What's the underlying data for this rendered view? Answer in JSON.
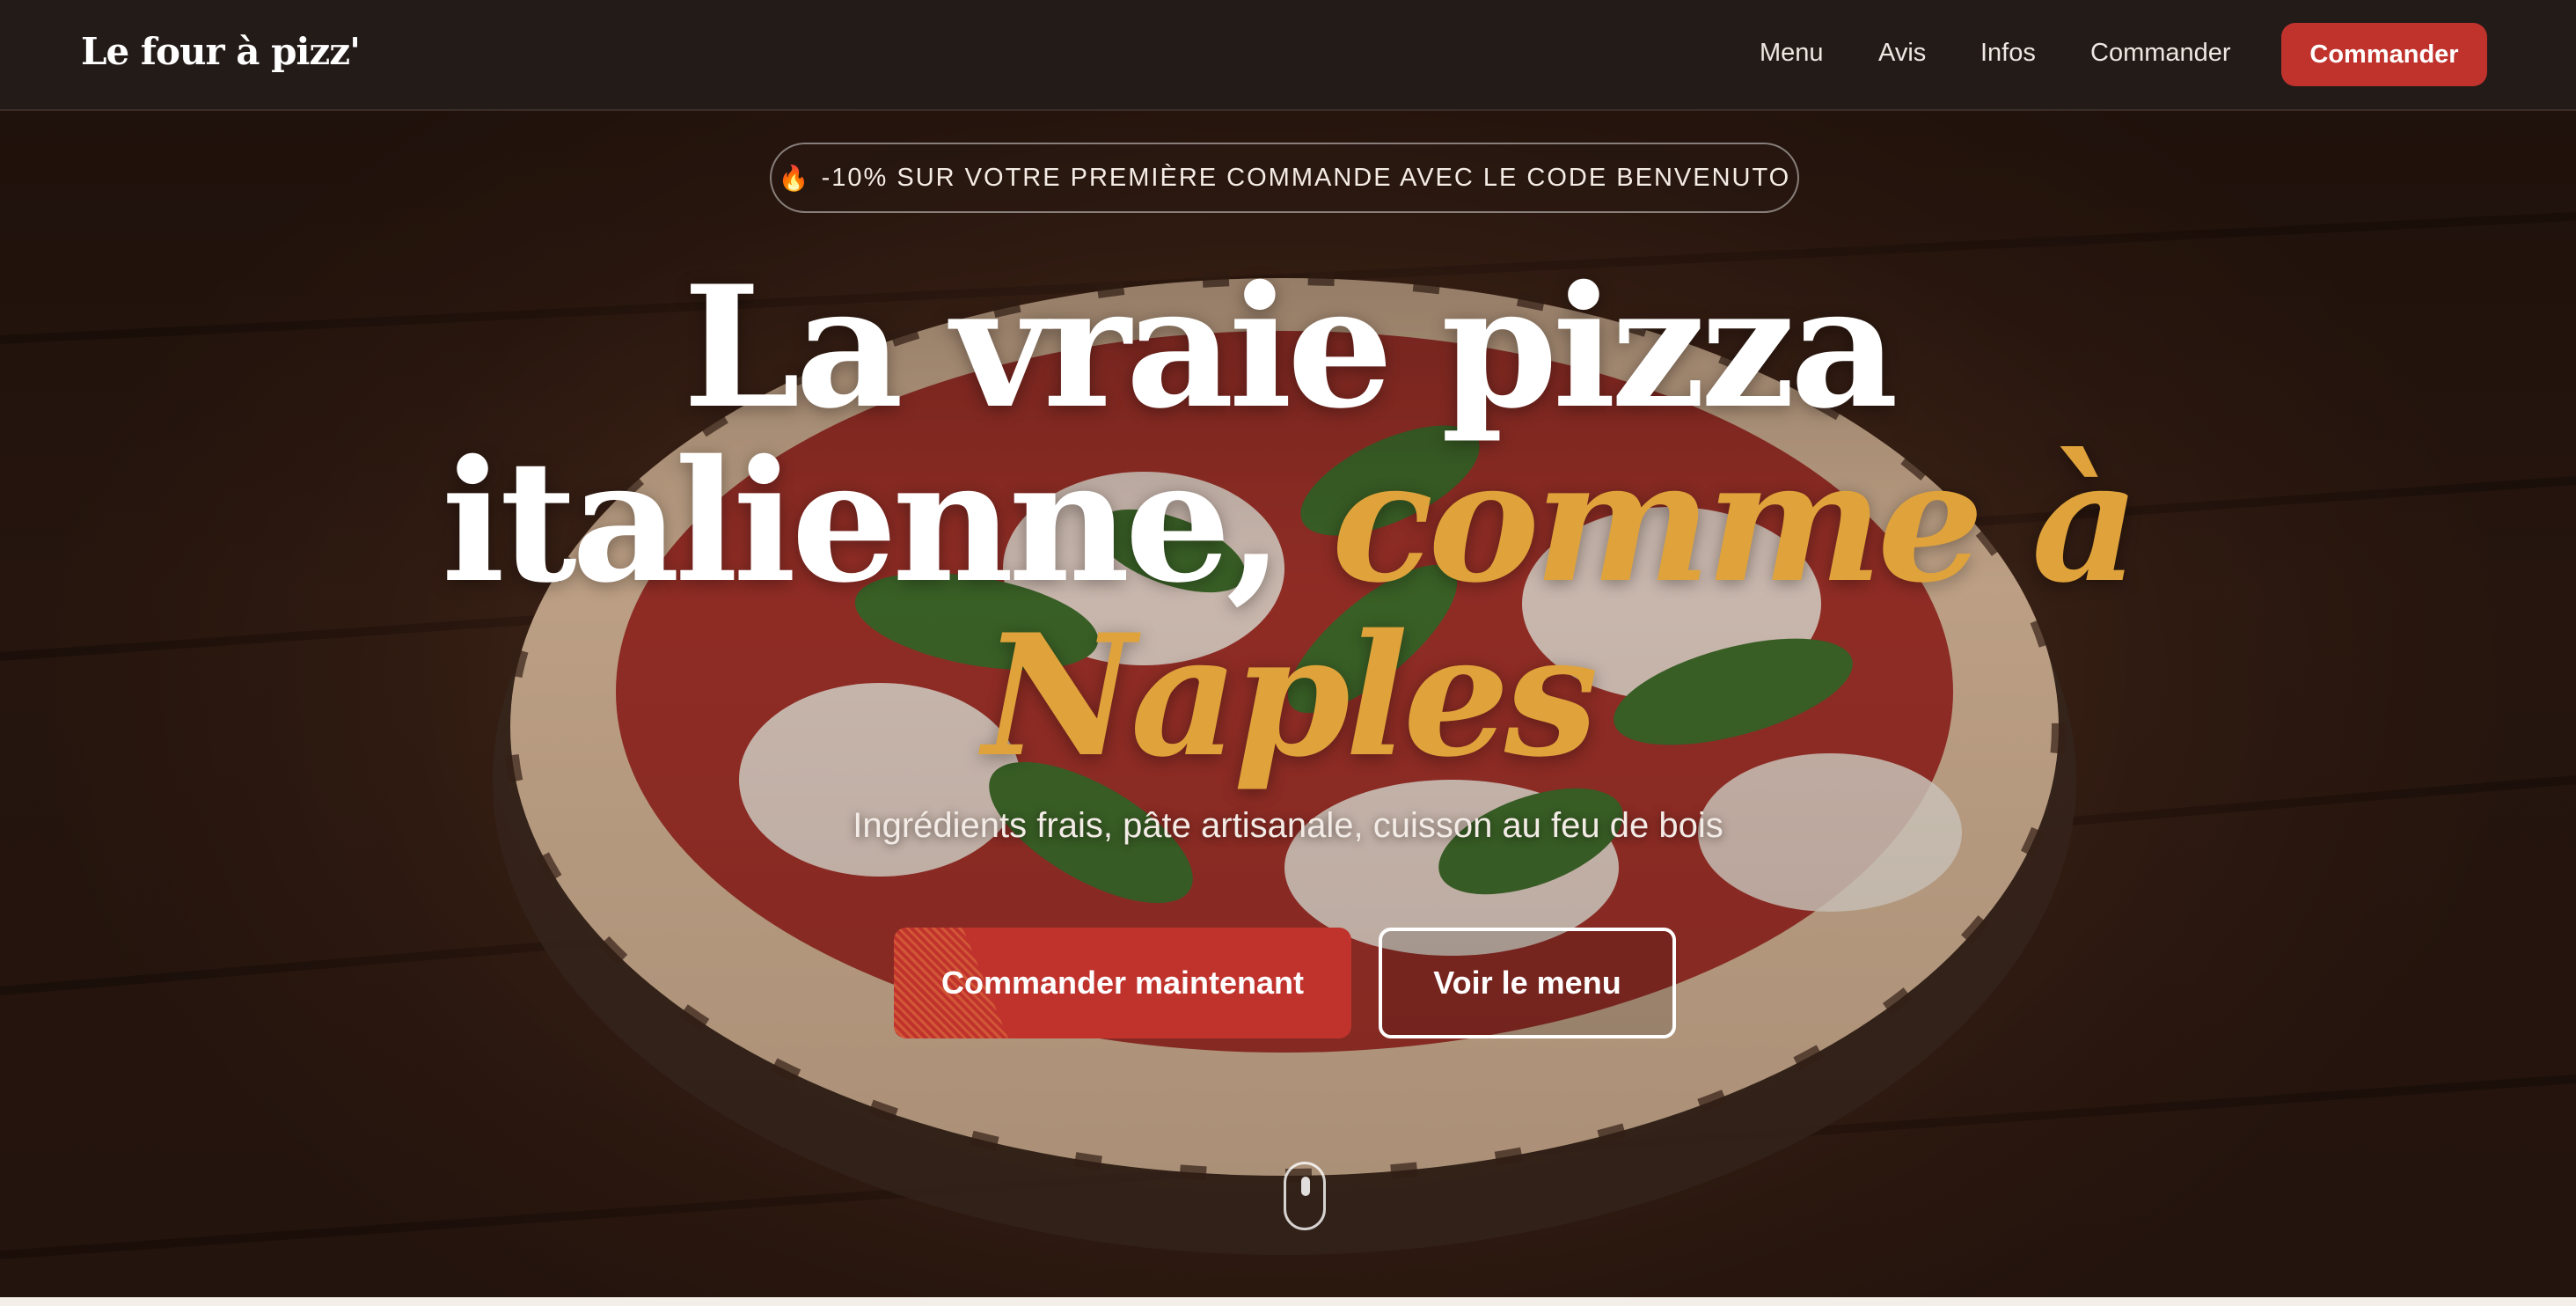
{
  "header": {
    "logo": "Le four à pizz'",
    "nav": {
      "menu": "Menu",
      "avis": "Avis",
      "infos": "Infos",
      "commander": "Commander"
    },
    "cta_label": "Commander"
  },
  "hero": {
    "promo_icon": "fire-icon",
    "promo_text": "-10% SUR VOTRE PREMIÈRE COMMANDE AVEC LE CODE BENVENUTO",
    "headline": {
      "line1": "La vraie pizza",
      "line2_plain": "italienne, ",
      "line2_accent": "comme à",
      "line3_accent": "Naples"
    },
    "subtitle": "Ingrédients frais, pâte artisanale, cuisson au feu de bois",
    "primary_button": "Commander maintenant",
    "secondary_button": "Voir le menu"
  },
  "colors": {
    "brand_red": "#c0332d",
    "accent_gold": "#e0a33b",
    "nav_bg": "#231b18"
  }
}
